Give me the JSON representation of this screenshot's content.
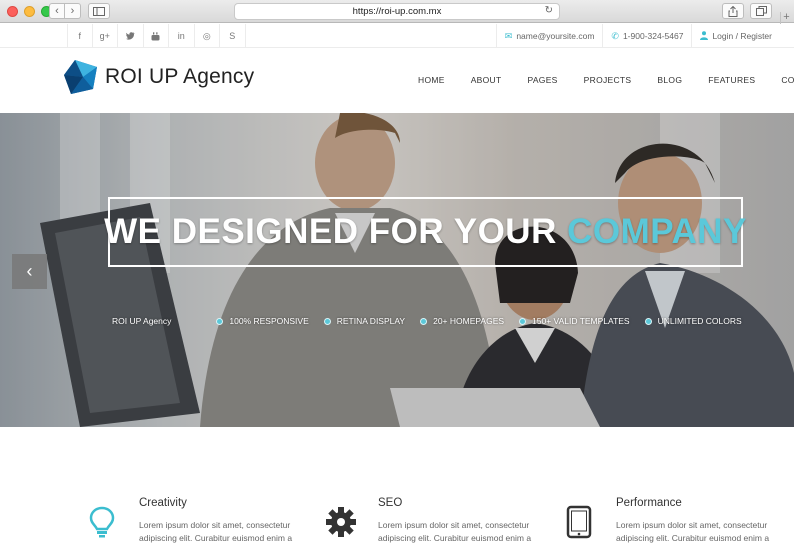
{
  "browser": {
    "url": "https://roi-up.com.mx"
  },
  "topbar": {
    "social_icons": [
      "facebook-icon",
      "google-plus-icon",
      "twitter-icon",
      "youtube-icon",
      "linkedin-icon",
      "dribbble-icon",
      "skype-icon"
    ],
    "social_glyphs": [
      "f",
      "g+",
      "t",
      "▶",
      "in",
      "◎",
      "S"
    ],
    "email": "name@yoursite.com",
    "phone": "1-900-324-5467",
    "login": "Login / Register"
  },
  "header": {
    "logo_text": "ROI UP Agency",
    "menu": [
      "HOME",
      "ABOUT",
      "PAGES",
      "PROJECTS",
      "BLOG",
      "FEATURES",
      "CONTACT"
    ]
  },
  "hero": {
    "headline_main": "WE DESIGNED FOR YOUR ",
    "headline_accent": "COMPANY",
    "brand": "ROI UP Agency",
    "features": [
      "100% RESPONSIVE",
      "RETINA DISPLAY",
      "20+ HOMEPAGES",
      "150+ VALID TEMPLATES",
      "UNLIMITED COLORS"
    ],
    "accent_color": "#5bc8d9"
  },
  "services": [
    {
      "icon": "lightbulb-icon",
      "title": "Creativity",
      "text": "Lorem ipsum dolor sit amet, consectetur adipiscing elit. Curabitur euismod enim a"
    },
    {
      "icon": "gear-icon",
      "title": "SEO",
      "text": "Lorem ipsum dolor sit amet, consectetur adipiscing elit. Curabitur euismod enim a"
    },
    {
      "icon": "tablet-icon",
      "title": "Performance",
      "text": "Lorem ipsum dolor sit amet, consectetur adipiscing elit. Curabitur euismod enim a"
    }
  ]
}
